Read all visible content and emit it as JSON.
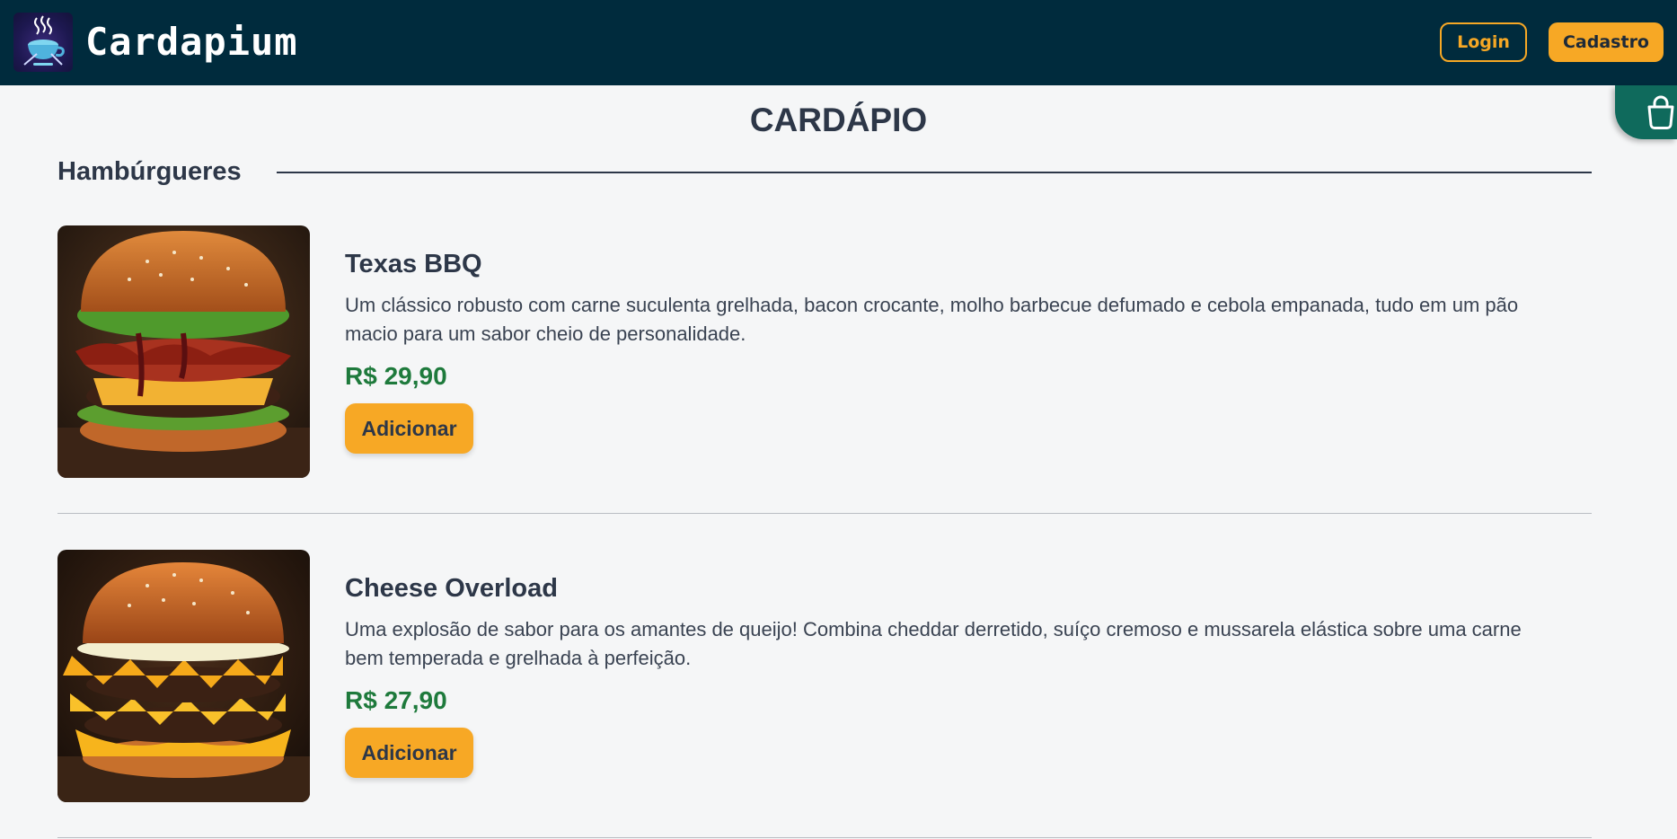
{
  "header": {
    "brand": "Cardapium",
    "login_label": "Login",
    "signup_label": "Cadastro"
  },
  "cart": {
    "icon": "shopping-bag-icon"
  },
  "page": {
    "title": "CARDÁPIO"
  },
  "section": {
    "title": "Hambúrgueres"
  },
  "products": [
    {
      "name": "Texas BBQ",
      "description": "Um clássico robusto com carne suculenta grelhada, bacon crocante, molho barbecue defumado e cebola empanada, tudo em um pão macio para um sabor cheio de personalidade.",
      "price": "R$ 29,90",
      "add_label": "Adicionar"
    },
    {
      "name": "Cheese Overload",
      "description": "Uma explosão de sabor para os amantes de queijo! Combina cheddar derretido, suíço cremoso e mussarela elástica sobre uma carne bem temperada e grelhada à perfeição.",
      "price": "R$ 27,90",
      "add_label": "Adicionar"
    }
  ],
  "colors": {
    "header_bg": "#002b3d",
    "accent": "#f7a825",
    "price": "#1e7a3c",
    "cart_tab": "#0f6a5c"
  }
}
